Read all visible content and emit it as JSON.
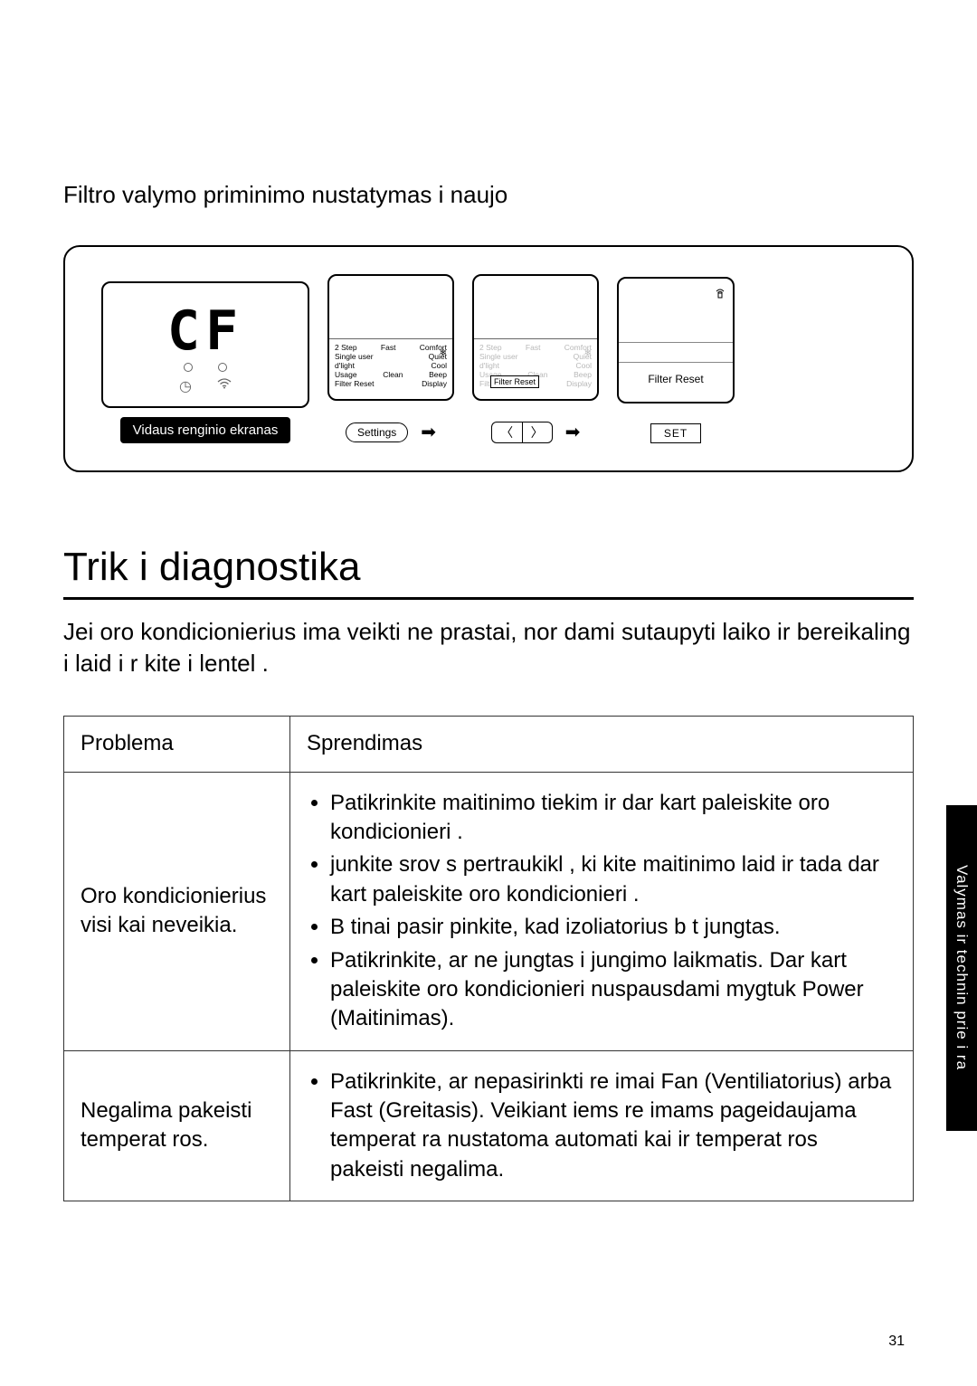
{
  "top_title": "Filtro valymo priminimo nustatymas i  naujo",
  "diagram": {
    "cf_text": "CF",
    "caption": "Vidaus  renginio ekranas",
    "remote_labels": {
      "r1a": "2 Step",
      "r1b": "Fast",
      "r1c": "Comfort",
      "r2a": "Single user",
      "r2b": "Quiet",
      "r3a": "d'light",
      "r3b": "Cool",
      "r4a": "Usage",
      "r4b": "Clean",
      "r4c": "Beep",
      "r5a": "Filter Reset",
      "r5b": "Display"
    },
    "highlight_label": "Filter Reset",
    "r3_text": "Filter Reset",
    "settings_label": "Settings",
    "set_label": "SET"
  },
  "trouble_heading": "Trik i  diagnostika",
  "intro": "Jei oro kondicionierius ima veikti ne prastai, nor dami sutaupyti laiko ir bereikaling  i laid  i r kite  i  lentel .",
  "table": {
    "h1": "Problema",
    "h2": "Sprendimas",
    "rows": [
      {
        "problem": "Oro kondicionierius visi kai neveikia.",
        "solutions": [
          "Patikrinkite maitinimo tiekim  ir dar kart  paleiskite oro kondicionieri .",
          " junkite srov s pertraukikl ,  ki kite maitinimo laid  ir tada dar kart  paleiskite oro kondicionieri .",
          "B tinai pasir pinkite, kad izoliatorius b t   jungtas.",
          "Patikrinkite, ar ne jungtas i jungimo laikmatis. Dar kart  paleiskite oro kondicionieri  nuspausdami mygtuk  Power (Maitinimas)."
        ]
      },
      {
        "problem": "Negalima pakeisti temperat ros.",
        "solutions": [
          "Patikrinkite, ar nepasirinkti re imai Fan (Ventiliatorius) arba Fast (Greitasis). Veikiant  iems re imams pageidaujama temperat ra nustatoma automati kai ir temperat ros pakeisti negalima."
        ]
      }
    ]
  },
  "sidetab": "Valymas ir technin  prie i ra",
  "pagenum": "31"
}
